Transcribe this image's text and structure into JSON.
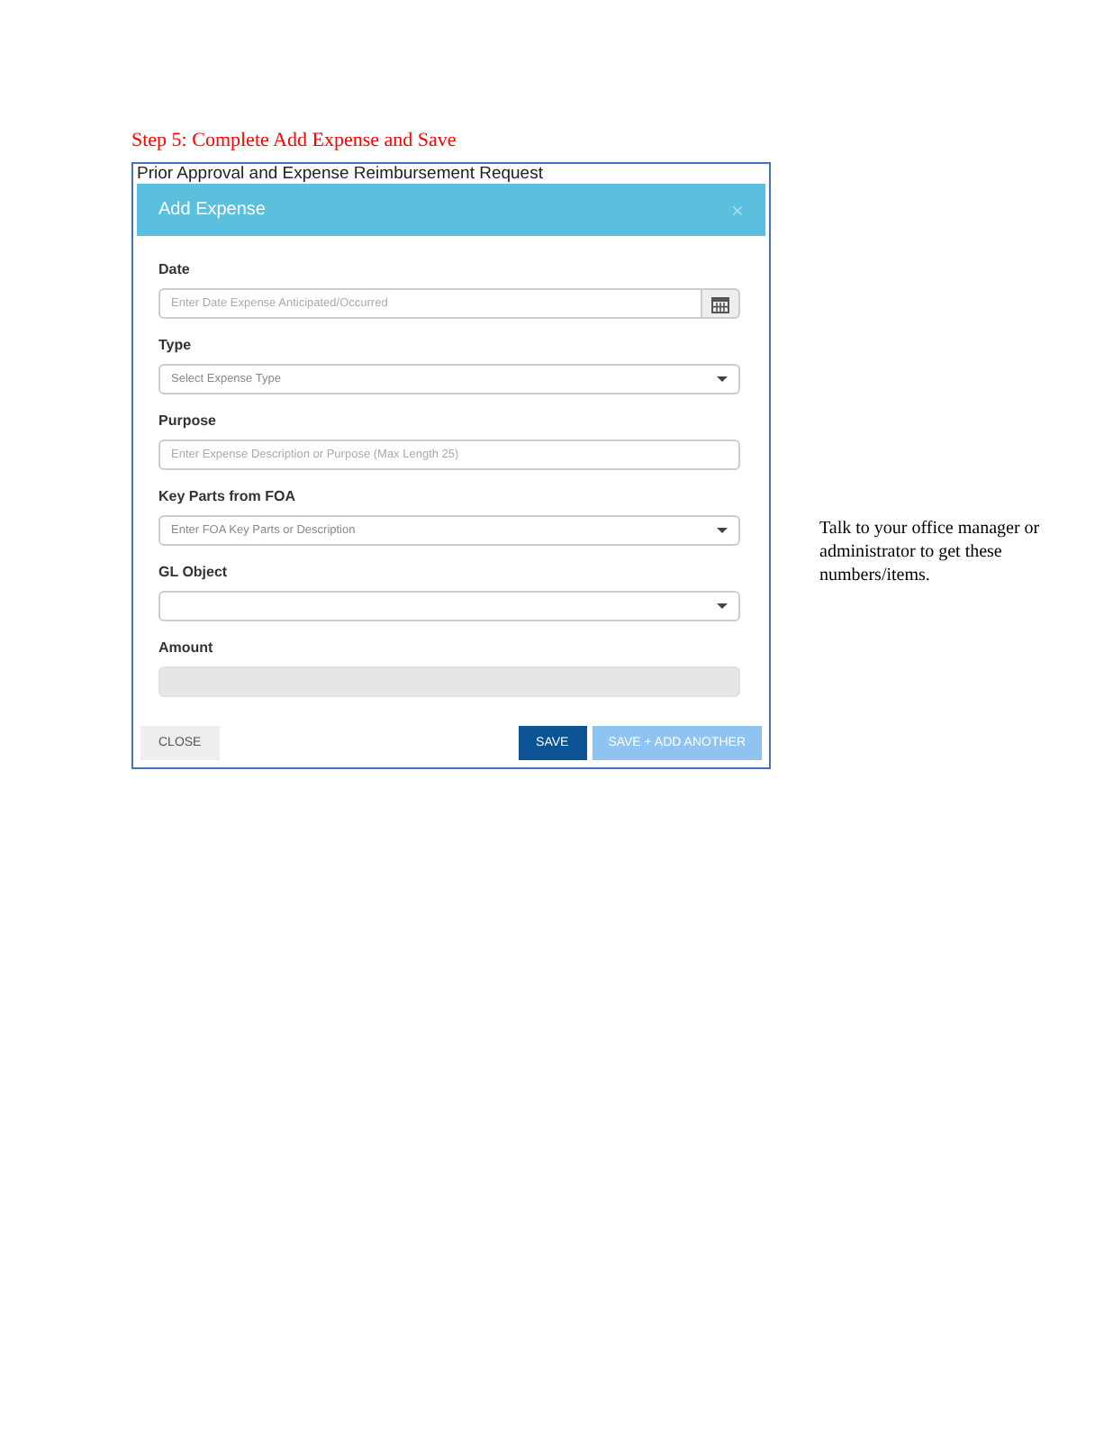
{
  "step_heading": "Step 5: Complete Add Expense and Save",
  "screenshot": {
    "background_title": "Prior Approval and Expense Reimbursement Request",
    "dialog": {
      "title": "Add Expense",
      "close_icon": "×",
      "fields": [
        {
          "label": "Date",
          "kind": "date",
          "placeholder": "Enter Date Expense Anticipated/Occurred",
          "disabled": false
        },
        {
          "label": "Type",
          "kind": "select",
          "placeholder": "Select Expense Type",
          "disabled": false
        },
        {
          "label": "Purpose",
          "kind": "text",
          "placeholder": "Enter Expense Description or Purpose (Max Length 25)",
          "disabled": false
        },
        {
          "label": "Key Parts from FOA",
          "kind": "select",
          "placeholder": "Enter FOA Key Parts or Description",
          "disabled": false
        },
        {
          "label": "GL Object",
          "kind": "select",
          "disabled": false
        },
        {
          "label": "Amount",
          "kind": "text",
          "disabled": true
        }
      ],
      "buttons": [
        {
          "label": "CLOSE",
          "kind": "default"
        },
        {
          "label": "SAVE",
          "kind": "primary"
        },
        {
          "label": "SAVE + ADD ANOTHER",
          "kind": "light"
        }
      ]
    }
  },
  "side_note": "Talk to your office manager or administrator to get these numbers/items."
}
